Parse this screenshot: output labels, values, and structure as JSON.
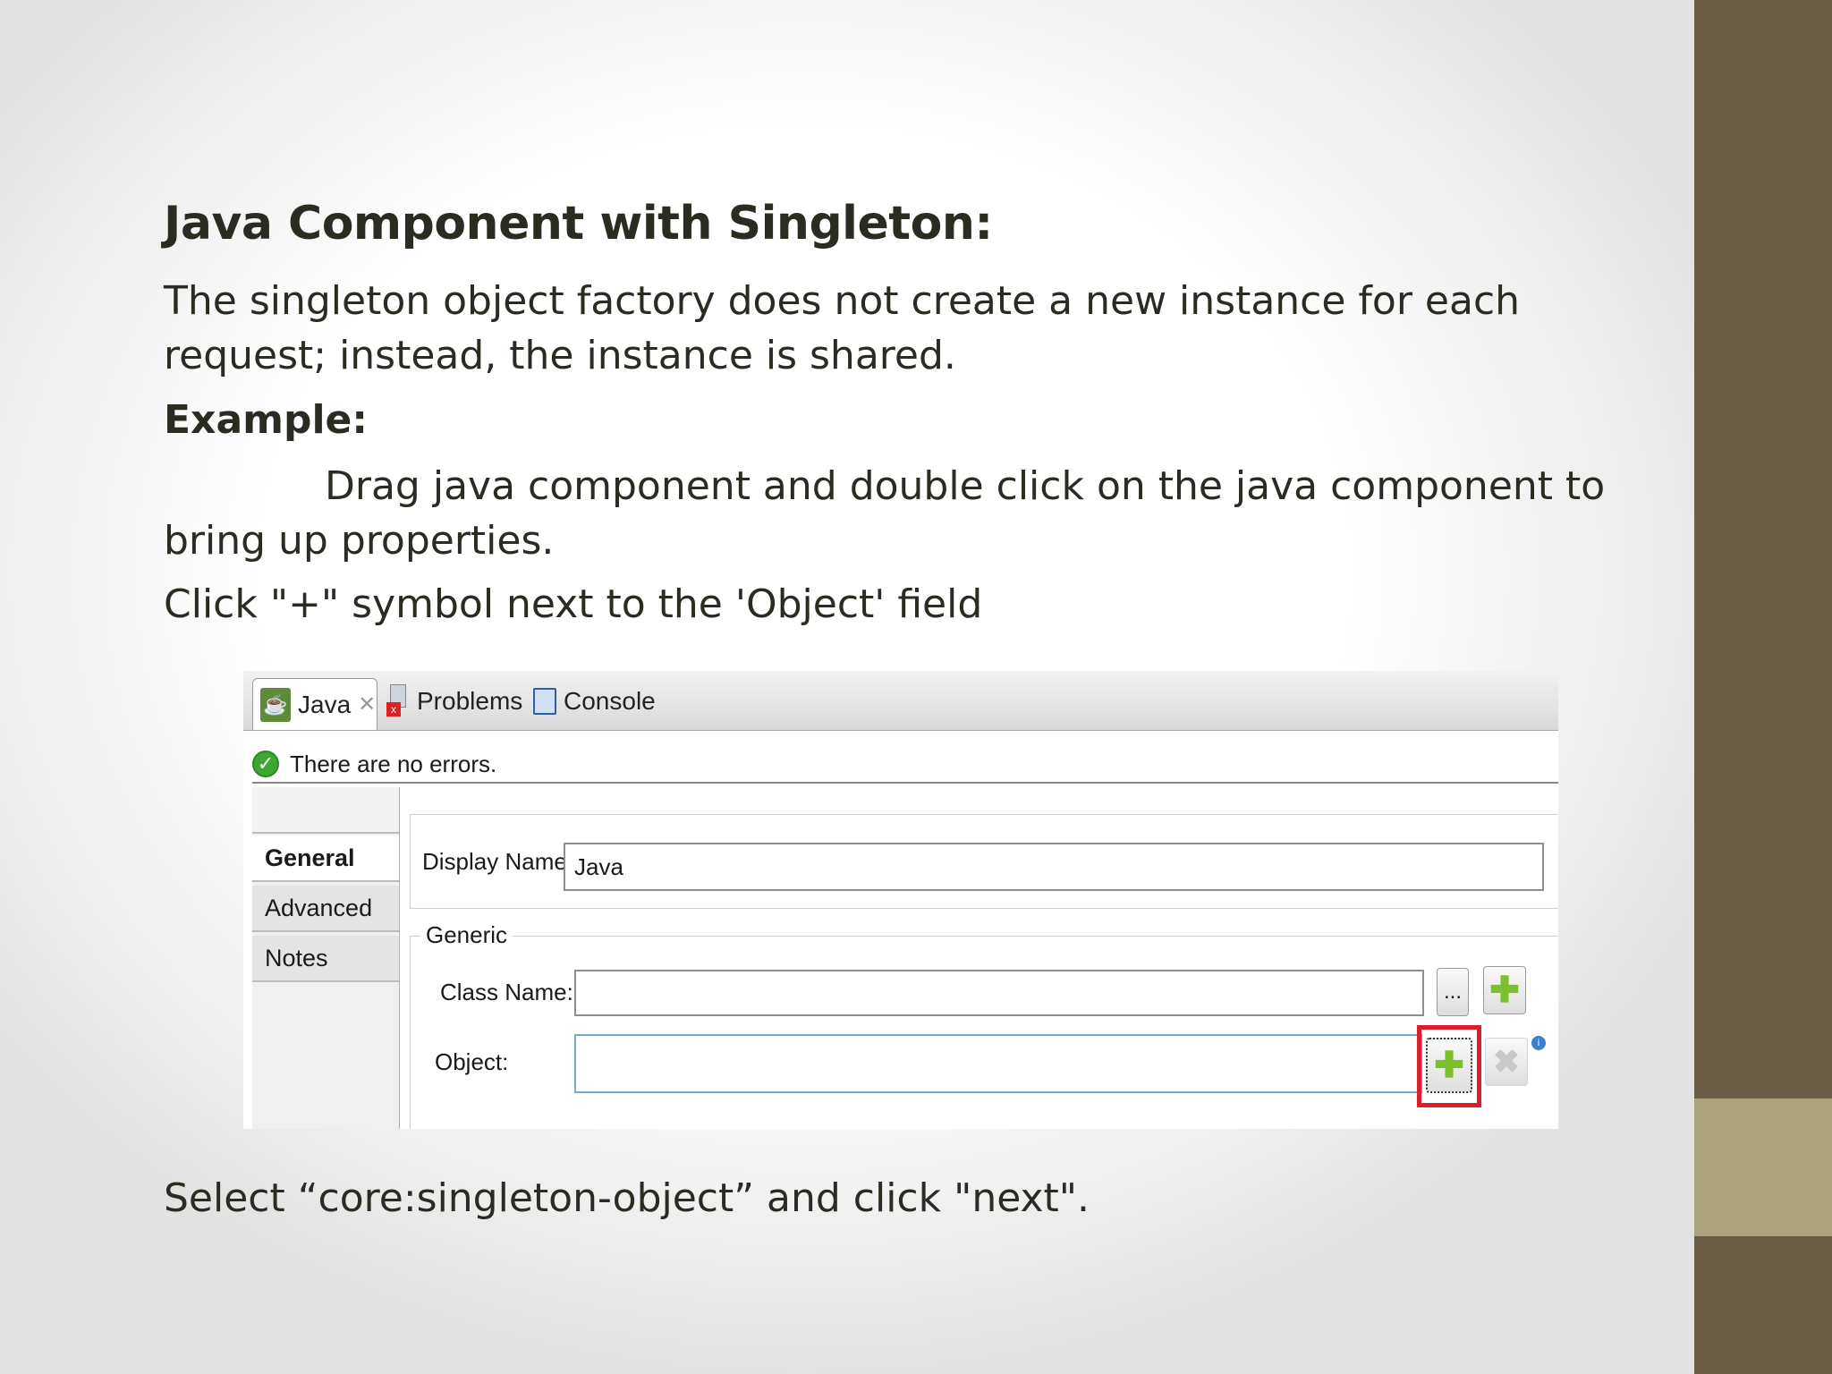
{
  "slide": {
    "title": "Java Component with Singleton:",
    "paragraph": "The singleton object factory does not create a new instance for each request; instead, the instance is shared.",
    "example_label": "Example:",
    "drag_instruction": "Drag java component and double click on the java component to bring up properties.",
    "click_instruction": "Click \"+\" symbol next to the 'Object'  field",
    "select_instruction": "Select “core:singleton-object” and click \"next\"."
  },
  "screenshot": {
    "tabs": [
      {
        "label": "Java",
        "icon": "java-icon",
        "active": true
      },
      {
        "label": "Problems",
        "icon": "problems-icon"
      },
      {
        "label": "Console",
        "icon": "console-icon"
      }
    ],
    "status_text": "There are no errors.",
    "side_items": [
      "General",
      "Advanced",
      "Notes"
    ],
    "display_name_label": "Display Name:",
    "display_name_value": "Java",
    "generic_legend": "Generic",
    "class_name_label": "Class Name:",
    "class_name_value": "",
    "browse_label": "...",
    "object_label": "Object:",
    "object_value": ""
  },
  "colors": {
    "right_band": "#6b5e46",
    "right_accent": "#aba47c",
    "highlight": "#e01e2a",
    "plus_green": "#7cc02b"
  }
}
